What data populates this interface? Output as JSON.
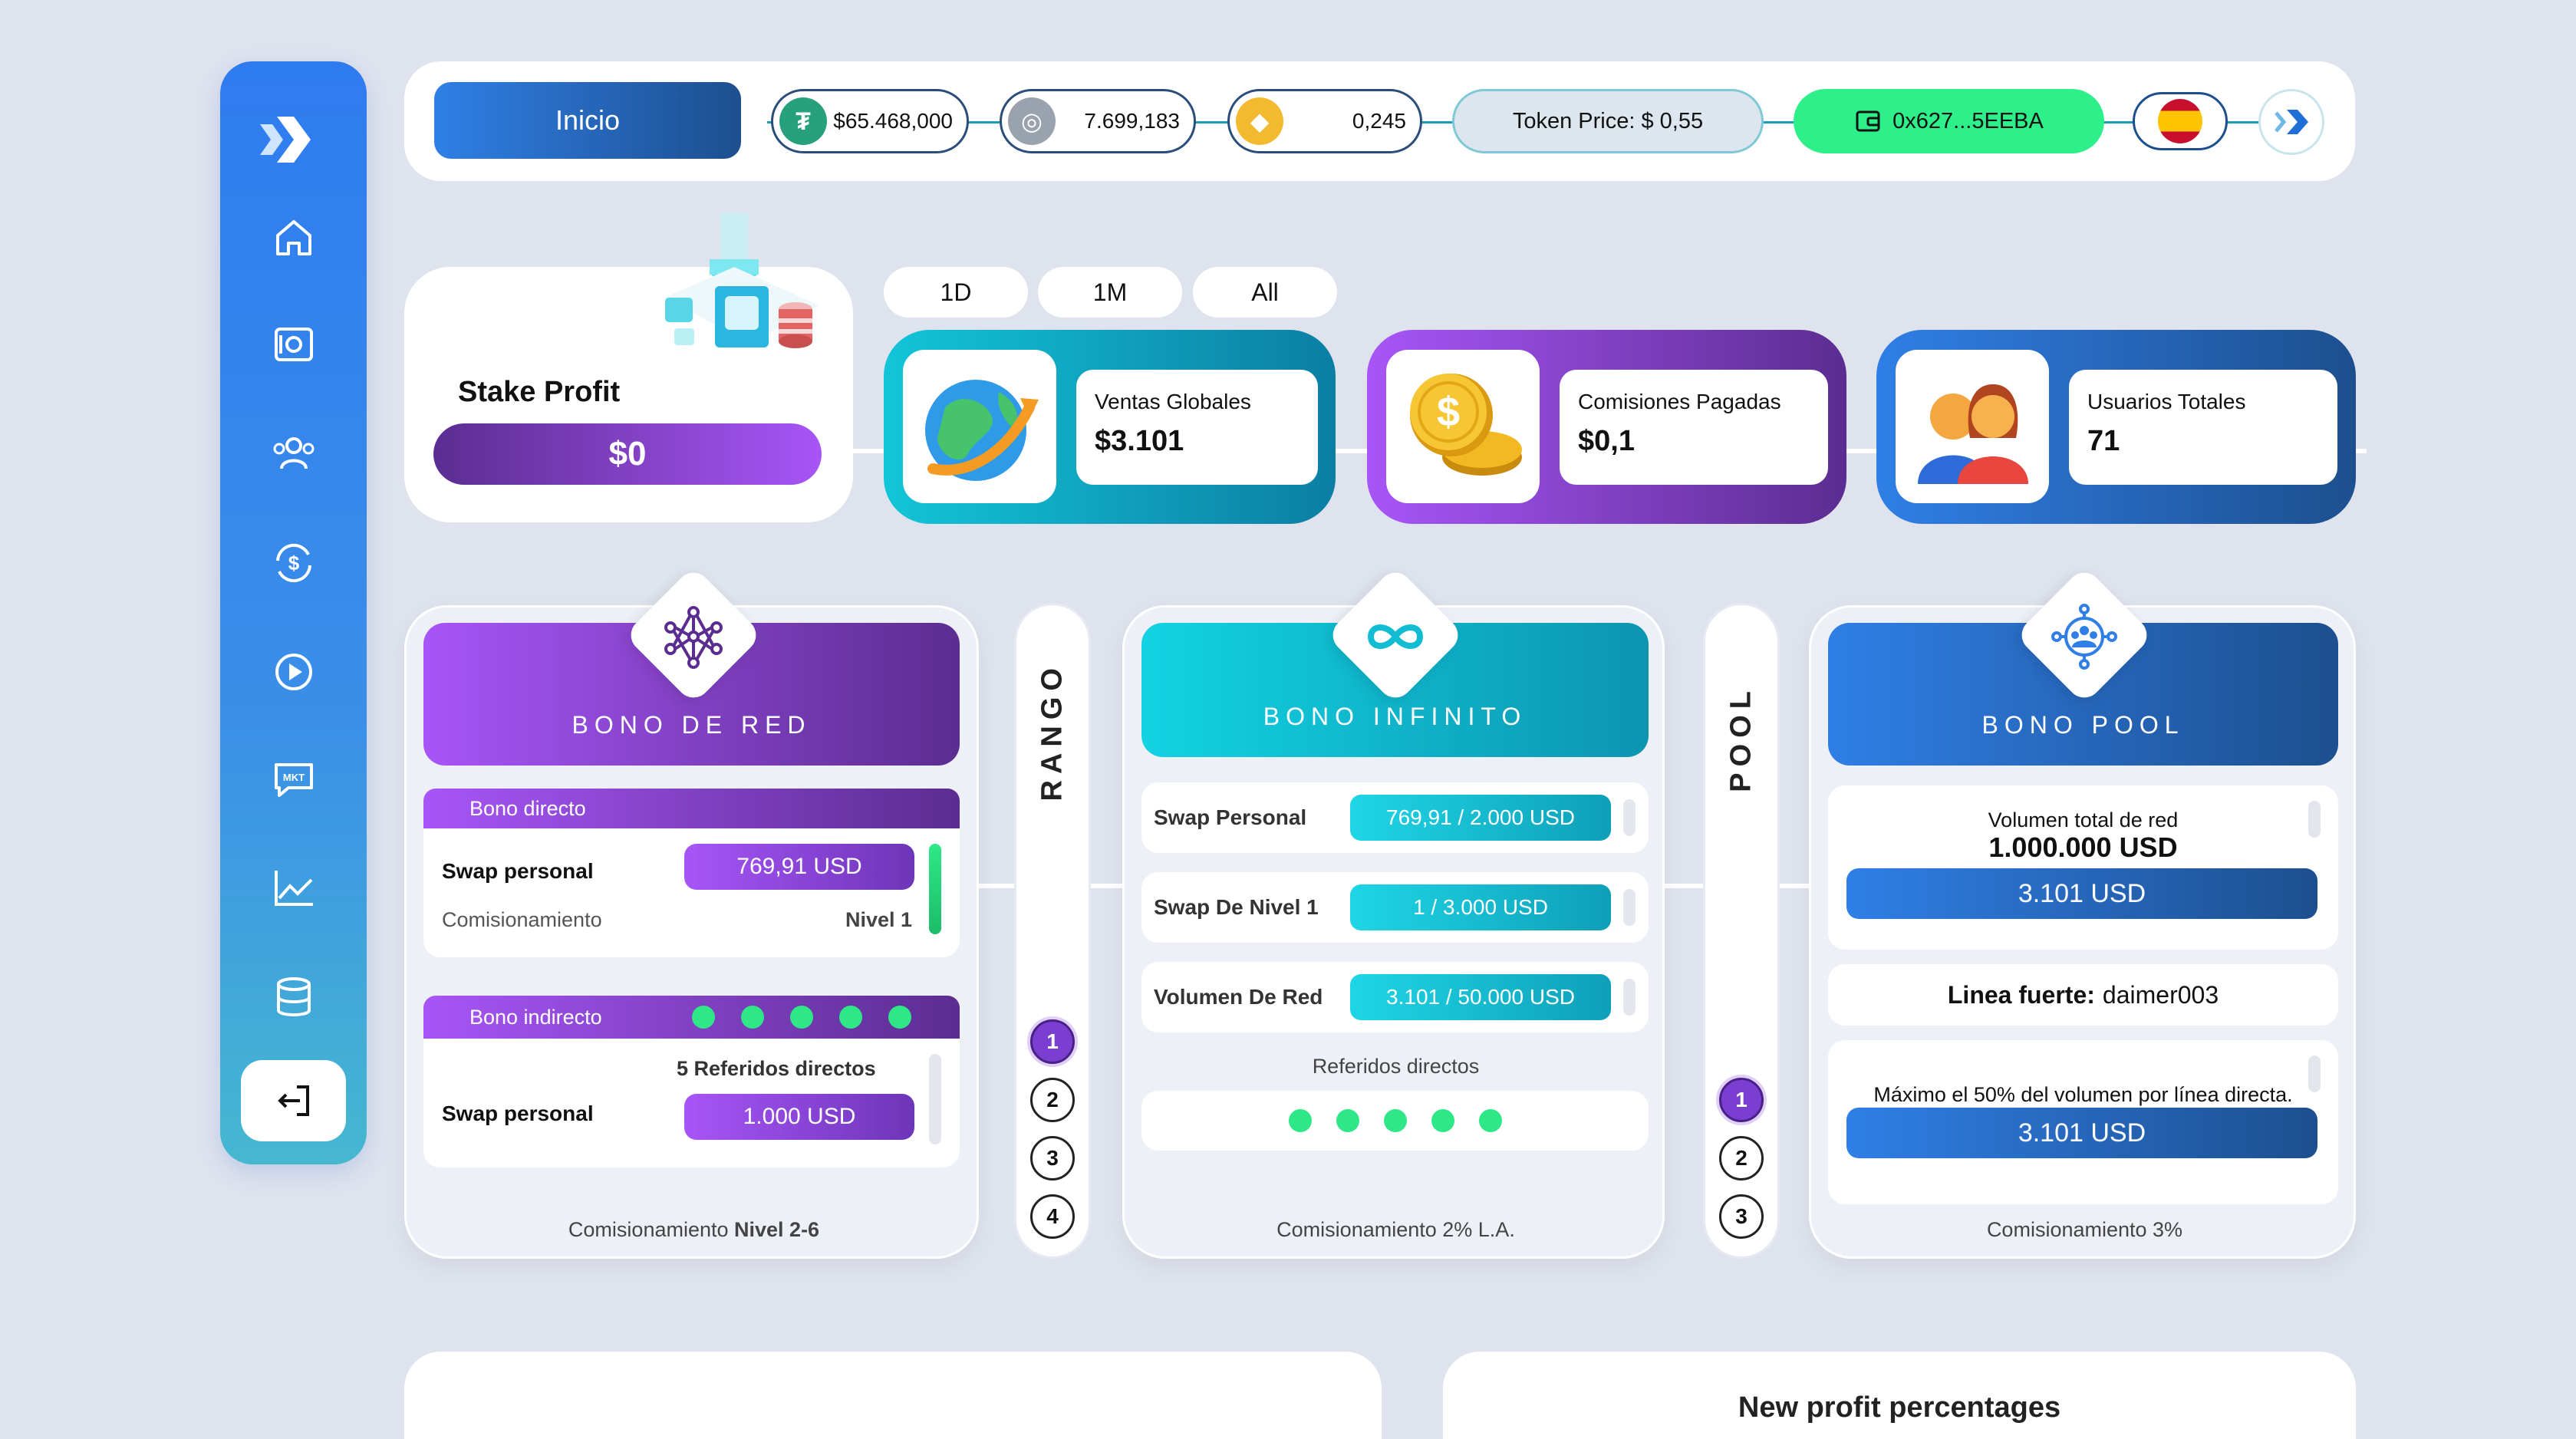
{
  "sidebar": {
    "items": [
      {
        "name": "home"
      },
      {
        "name": "vault"
      },
      {
        "name": "users"
      },
      {
        "name": "dollar-exchange"
      },
      {
        "name": "play"
      },
      {
        "name": "market-chat",
        "label": "MKT"
      },
      {
        "name": "chart"
      },
      {
        "name": "database"
      },
      {
        "name": "logout"
      }
    ]
  },
  "topbar": {
    "home_label": "Inicio",
    "usdt_value": "$65.468,000",
    "token_value": "7.699,183",
    "bnb_value": "0,245",
    "token_price": "Token Price: $ 0,55",
    "wallet": "0x627...5EEBA"
  },
  "stake": {
    "title": "Stake Profit",
    "value": "$0"
  },
  "periods": [
    "1D",
    "1M",
    "All"
  ],
  "stats": [
    {
      "label": "Ventas Globales",
      "value": "$3.101",
      "gradient": [
        "#12c5d9",
        "#0c7ea3"
      ]
    },
    {
      "label": "Comisiones Pagadas",
      "value": "$0,1",
      "gradient": [
        "#a855f7",
        "#5b2d91"
      ]
    },
    {
      "label": "Usuarios Totales",
      "value": "71",
      "gradient": [
        "#2f7fe6",
        "#1d4f8f"
      ]
    }
  ],
  "bono_red": {
    "title": "BONO DE RED",
    "directo_label": "Bono directo",
    "swap_label": "Swap personal",
    "swap_value": "769,91 USD",
    "comision_label": "Comisionamiento",
    "nivel": "Nivel 1",
    "indirecto_label": "Bono indirecto",
    "referidos": "5 Referidos directos",
    "swap2_label": "Swap personal",
    "swap2_value": "1.000 USD",
    "footer_prefix": "Comisionamiento ",
    "footer_bold": "Nivel 2-6"
  },
  "rango": {
    "label": "RANGO",
    "levels": [
      "1",
      "2",
      "3",
      "4"
    ]
  },
  "bono_infinito": {
    "title": "BONO INFINITO",
    "rows": [
      {
        "label": "Swap Personal",
        "value": "769,91 / 2.000 USD"
      },
      {
        "label": "Swap De Nivel 1",
        "value": "1 / 3.000 USD"
      },
      {
        "label": "Volumen De Red",
        "value": "3.101 / 50.000 USD"
      }
    ],
    "referidos_label": "Referidos directos",
    "footer": "Comisionamiento 2% L.A."
  },
  "pool": {
    "label": "POOL",
    "levels": [
      "1",
      "2",
      "3"
    ]
  },
  "bono_pool": {
    "title": "BONO POOL",
    "volumen_label": "Volumen total de red",
    "volumen_value": "1.000.000 USD",
    "volumen_pill": "3.101 USD",
    "linea_label": "Linea fuerte:",
    "linea_value": "daimer003",
    "max_label": "Máximo el 50% del volumen por línea directa.",
    "max_pill": "3.101 USD",
    "footer": "Comisionamiento 3%"
  },
  "bottom": {
    "right_title": "New profit percentages"
  },
  "colors": {
    "purple": "#7a3fd1",
    "cyan": "#12c5d9",
    "blue": "#2f7fe6",
    "green": "#2ee887"
  }
}
